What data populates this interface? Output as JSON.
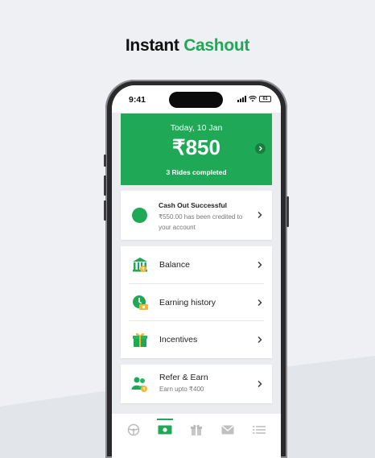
{
  "headline": {
    "part1": "Instant",
    "part2": "Cashout"
  },
  "status": {
    "time": "9:41",
    "battery": "61"
  },
  "earnings": {
    "date": "Today, 10 Jan",
    "amount": "₹850",
    "rides": "3 Rides completed"
  },
  "cashout": {
    "title": "Cash Out Successful",
    "message": "₹550.00 has been credited to your account"
  },
  "menu": [
    {
      "label": "Balance",
      "icon": "bank-icon"
    },
    {
      "label": "Earning history",
      "icon": "earnings-history-icon"
    },
    {
      "label": "Incentives",
      "icon": "gift-icon"
    }
  ],
  "refer": {
    "label": "Refer & Earn",
    "sub": "Earn upto ₹400",
    "icon": "refer-people-icon"
  },
  "tabs": [
    {
      "name": "steering-wheel-icon",
      "active": false
    },
    {
      "name": "cash-icon",
      "active": true
    },
    {
      "name": "gift-icon",
      "active": false
    },
    {
      "name": "mail-icon",
      "active": false
    },
    {
      "name": "list-icon",
      "active": false
    }
  ],
  "colors": {
    "accent": "#1fa855",
    "background": "#eef0f4",
    "phone_frame": "#2a2a2d"
  }
}
